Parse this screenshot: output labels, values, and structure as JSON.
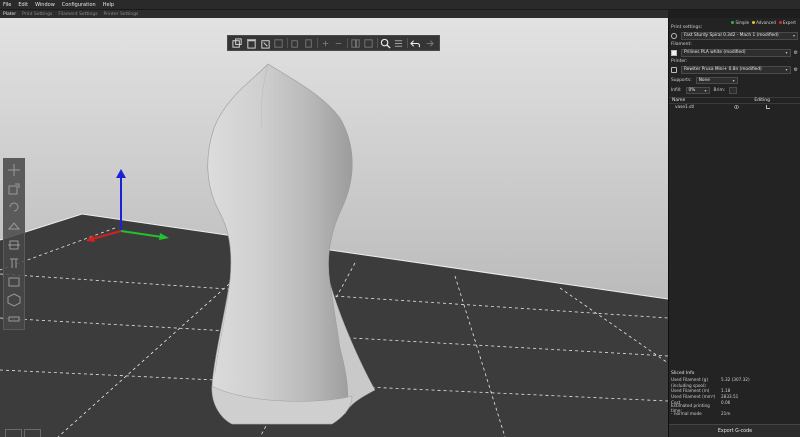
{
  "menu": [
    "File",
    "Edit",
    "Window",
    "Configuration",
    "Help"
  ],
  "tabs": [
    {
      "label": "Plater",
      "active": true
    },
    {
      "label": "Print Settings",
      "active": false
    },
    {
      "label": "Filament Settings",
      "active": false
    },
    {
      "label": "Printer Settings",
      "active": false
    }
  ],
  "toolbar": {
    "icons": [
      "add-icon",
      "delete-icon",
      "delete-all-icon",
      "arrange-icon",
      "copy-icon",
      "paste-icon",
      "add-instance-icon",
      "remove-instance-icon",
      "split-objects-icon",
      "split-parts-icon",
      "search-icon",
      "layers-editing-icon",
      "undo-icon",
      "redo-icon"
    ]
  },
  "sidebar": {
    "modes": [
      {
        "label": "Simple",
        "color": "#2fb545"
      },
      {
        "label": "Advanced",
        "color": "#e6c619"
      },
      {
        "label": "Expert",
        "color": "#e02a2a"
      }
    ],
    "print_settings_label": "Print settings:",
    "print_preset": "Fast Sturdy Spiral 0.3d2 - Mach 1 (modified)",
    "filament_label": "Filament:",
    "filament_preset": "Prilines PLA white (modified)",
    "printer_label": "Printer:",
    "printer_preset": "Rewiter Prusa Mini+ 0.8n (modified)",
    "supports_label": "Supports:",
    "supports_value": "None",
    "infill_label": "Infill:",
    "infill_value": "0%",
    "brim_label": "Brim:",
    "list_header_name": "Name",
    "list_header_editing": "Editing",
    "objects": [
      {
        "name": "vase1.stl"
      }
    ]
  },
  "sliced_info": {
    "title": "Sliced Info",
    "rows": [
      {
        "key": "Used Filament (g)",
        "value": "5.32 (307.32)"
      },
      {
        "key": "    (including spool)",
        "value": ""
      },
      {
        "key": "Used Filament (m)",
        "value": "1.18"
      },
      {
        "key": "Used Filament (mm³)",
        "value": "2833.51"
      },
      {
        "key": "Cost",
        "value": "0.06"
      },
      {
        "key": "Estimated printing time:",
        "value": ""
      },
      {
        "key": "  - normal mode",
        "value": "21m"
      }
    ]
  },
  "export_label": "Export G-code",
  "colors": {
    "accent": "#f0812b",
    "axis_x": "#d62020",
    "axis_y": "#22c22e",
    "axis_z": "#1a22d8"
  }
}
